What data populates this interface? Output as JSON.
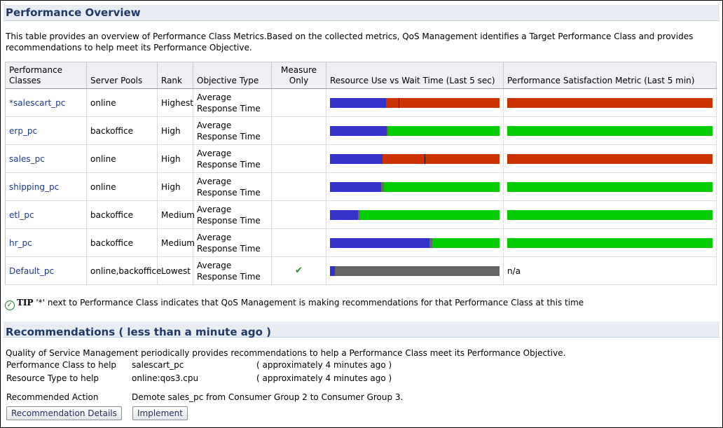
{
  "overview": {
    "title": "Performance Overview",
    "description": "This table provides an overview of Performance Class Metrics.Based on the collected metrics, QoS Management identifies a Target Performance Class and provides recommendations to help meet its Performance Objective.",
    "columns": {
      "performance_classes": "Performance Classes",
      "server_pools": "Server Pools",
      "rank": "Rank",
      "objective_type": "Objective Type",
      "measure_only": "Measure Only",
      "resource_use": "Resource Use vs Wait Time (Last 5 sec)",
      "satisfaction": "Performance Satisfaction Metric (Last 5 min)"
    },
    "rows": [
      {
        "name": "*salescart_pc",
        "pool": "online",
        "rank": "Highest",
        "objective": "Average Response Time",
        "measure_only": "",
        "resource": [
          {
            "fraction": 0.33,
            "color": "#3333cc"
          },
          {
            "fraction": 0.67,
            "color": "#cc3300"
          }
        ],
        "resource_marker": 0.405,
        "satisfaction": {
          "color": "#cc3300",
          "text": ""
        }
      },
      {
        "name": "erp_pc",
        "pool": "backoffice",
        "rank": "High",
        "objective": "Average Response Time",
        "measure_only": "",
        "resource": [
          {
            "fraction": 0.335,
            "color": "#3333cc"
          },
          {
            "fraction": 0.008,
            "color": "#666666"
          },
          {
            "fraction": 0.657,
            "color": "#00cc00"
          }
        ],
        "resource_marker": null,
        "satisfaction": {
          "color": "#00cc00",
          "text": ""
        }
      },
      {
        "name": "sales_pc",
        "pool": "online",
        "rank": "High",
        "objective": "Average Response Time",
        "measure_only": "",
        "resource": [
          {
            "fraction": 0.31,
            "color": "#3333cc"
          },
          {
            "fraction": 0.69,
            "color": "#cc3300"
          }
        ],
        "resource_marker": 0.557,
        "satisfaction": {
          "color": "#cc3300",
          "text": ""
        }
      },
      {
        "name": "shipping_pc",
        "pool": "online",
        "rank": "High",
        "objective": "Average Response Time",
        "measure_only": "",
        "resource": [
          {
            "fraction": 0.3,
            "color": "#3333cc"
          },
          {
            "fraction": 0.02,
            "color": "#666666"
          },
          {
            "fraction": 0.68,
            "color": "#00cc00"
          }
        ],
        "resource_marker": null,
        "satisfaction": {
          "color": "#00cc00",
          "text": ""
        }
      },
      {
        "name": "etl_pc",
        "pool": "backoffice",
        "rank": "Medium",
        "objective": "Average Response Time",
        "measure_only": "",
        "resource": [
          {
            "fraction": 0.165,
            "color": "#3333cc"
          },
          {
            "fraction": 0.008,
            "color": "#666666"
          },
          {
            "fraction": 0.827,
            "color": "#00cc00"
          }
        ],
        "resource_marker": null,
        "satisfaction": {
          "color": "#00cc00",
          "text": ""
        }
      },
      {
        "name": "hr_pc",
        "pool": "backoffice",
        "rank": "Medium",
        "objective": "Average Response Time",
        "measure_only": "",
        "resource": [
          {
            "fraction": 0.585,
            "color": "#3333cc"
          },
          {
            "fraction": 0.02,
            "color": "#666666"
          },
          {
            "fraction": 0.395,
            "color": "#00cc00"
          }
        ],
        "resource_marker": null,
        "satisfaction": {
          "color": "#00cc00",
          "text": ""
        }
      },
      {
        "name": "Default_pc",
        "pool": "online,backoffice",
        "rank": "Lowest",
        "objective": "Average Response Time",
        "measure_only": "✔",
        "resource": [
          {
            "fraction": 0.03,
            "color": "#3333cc"
          },
          {
            "fraction": 0.97,
            "color": "#666666"
          }
        ],
        "resource_marker": null,
        "satisfaction": {
          "color": "",
          "text": "n/a"
        }
      }
    ]
  },
  "tip": {
    "label": "TIP",
    "text": "'*' next to Performance Class indicates that QoS Management is making recommendations for that Performance Class at this time"
  },
  "recommendations": {
    "title": "Recommendations ( less than a minute ago )",
    "description": "Quality of Service Management periodically provides recommendations to help a Performance Class meet its Performance Objective.",
    "performance_class_label": "Performance Class to help",
    "performance_class_value": "salescart_pc",
    "performance_class_age": "( approximately 4 minutes ago )",
    "resource_type_label": "Resource Type to help",
    "resource_type_value": "online:qos3.cpu",
    "resource_type_age": "( approximately 4 minutes ago )",
    "action_label": "Recommended Action",
    "action_value": "Demote sales_pc from Consumer Group 2 to Consumer Group 3.",
    "details_button": "Recommendation Details",
    "implement_button": "Implement"
  }
}
